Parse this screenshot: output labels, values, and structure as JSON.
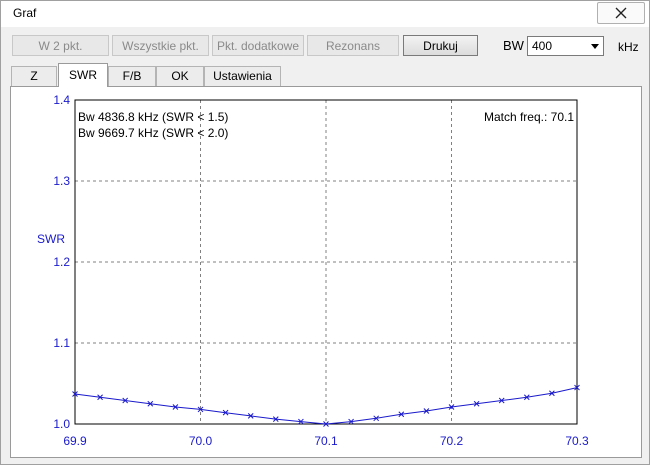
{
  "window": {
    "title": "Graf"
  },
  "toolbar": {
    "buttons": [
      {
        "label": "W 2 pkt.",
        "enabled": false
      },
      {
        "label": "Wszystkie pkt.",
        "enabled": false
      },
      {
        "label": "Pkt. dodatkowe",
        "enabled": false
      },
      {
        "label": "Rezonans",
        "enabled": false
      },
      {
        "label": "Drukuj",
        "enabled": true
      }
    ],
    "bw_label": "BW",
    "bw_value": "400",
    "bw_unit": "kHz"
  },
  "tabs": [
    {
      "label": "Z",
      "active": false
    },
    {
      "label": "SWR",
      "active": true
    },
    {
      "label": "F/B",
      "active": false
    },
    {
      "label": "OK",
      "active": false
    },
    {
      "label": "Ustawienia",
      "active": false
    }
  ],
  "colors": {
    "axis_text": "#1a1acc",
    "series": "#1a1acc",
    "grid": "#808080"
  },
  "chart_data": {
    "type": "line",
    "ylabel": "SWR",
    "xlim": [
      69.9,
      70.3
    ],
    "ylim": [
      1.0,
      1.4
    ],
    "xticks": [
      "69.9",
      "70.0",
      "70.1",
      "70.2",
      "70.3"
    ],
    "yticks": [
      "1.0",
      "1.1",
      "1.2",
      "1.3",
      "1.4"
    ],
    "grid": true,
    "annotations": [
      "Bw 4836.8 kHz (SWR < 1.5)",
      "Bw 9669.7 kHz (SWR < 2.0)",
      "Match freq.: 70.1"
    ],
    "series": [
      {
        "x": [
          69.9,
          69.92,
          69.94,
          69.96,
          69.98,
          70.0,
          70.02,
          70.04,
          70.06,
          70.08,
          70.1,
          70.12,
          70.14,
          70.16,
          70.18,
          70.2,
          70.22,
          70.24,
          70.26,
          70.28,
          70.3
        ],
        "y": [
          1.037,
          1.033,
          1.029,
          1.025,
          1.021,
          1.018,
          1.014,
          1.01,
          1.006,
          1.003,
          1.0,
          1.003,
          1.007,
          1.012,
          1.016,
          1.021,
          1.025,
          1.029,
          1.033,
          1.038,
          1.045
        ]
      }
    ]
  }
}
